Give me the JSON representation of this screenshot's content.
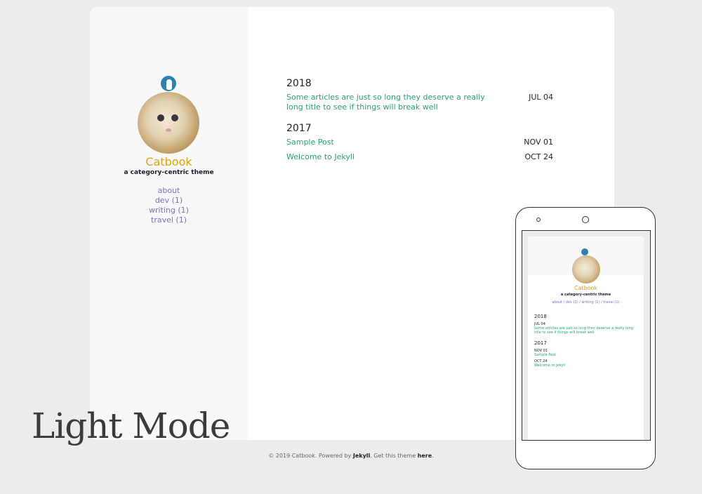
{
  "site": {
    "name": "Catbook",
    "tagline": "a category-centric theme"
  },
  "nav": [
    {
      "label": "about"
    },
    {
      "label": "dev (1)"
    },
    {
      "label": "writing (1)"
    },
    {
      "label": "travel (1)"
    }
  ],
  "archive": [
    {
      "year": "2018",
      "posts": [
        {
          "title": "Some articles are just so long they deserve a really long title to see if things will break well",
          "date": "JUL 04"
        }
      ]
    },
    {
      "year": "2017",
      "posts": [
        {
          "title": "Sample Post",
          "date": "NOV 01"
        },
        {
          "title": "Welcome to Jekyll",
          "date": "OCT 24"
        }
      ]
    }
  ],
  "footer": {
    "copyright": "© 2019 Catbook. Powered by ",
    "jekyll": "Jekyll",
    "middle": ". Get this theme ",
    "here": "here",
    "end": "."
  },
  "mode_label": "Light Mode",
  "mobile": {
    "nav_line": "about / dev (1) / writing (1) / travel (1)"
  },
  "colors": {
    "brand": "#e0a312",
    "link": "#2a9d7d",
    "nav": "#7c70b8"
  }
}
